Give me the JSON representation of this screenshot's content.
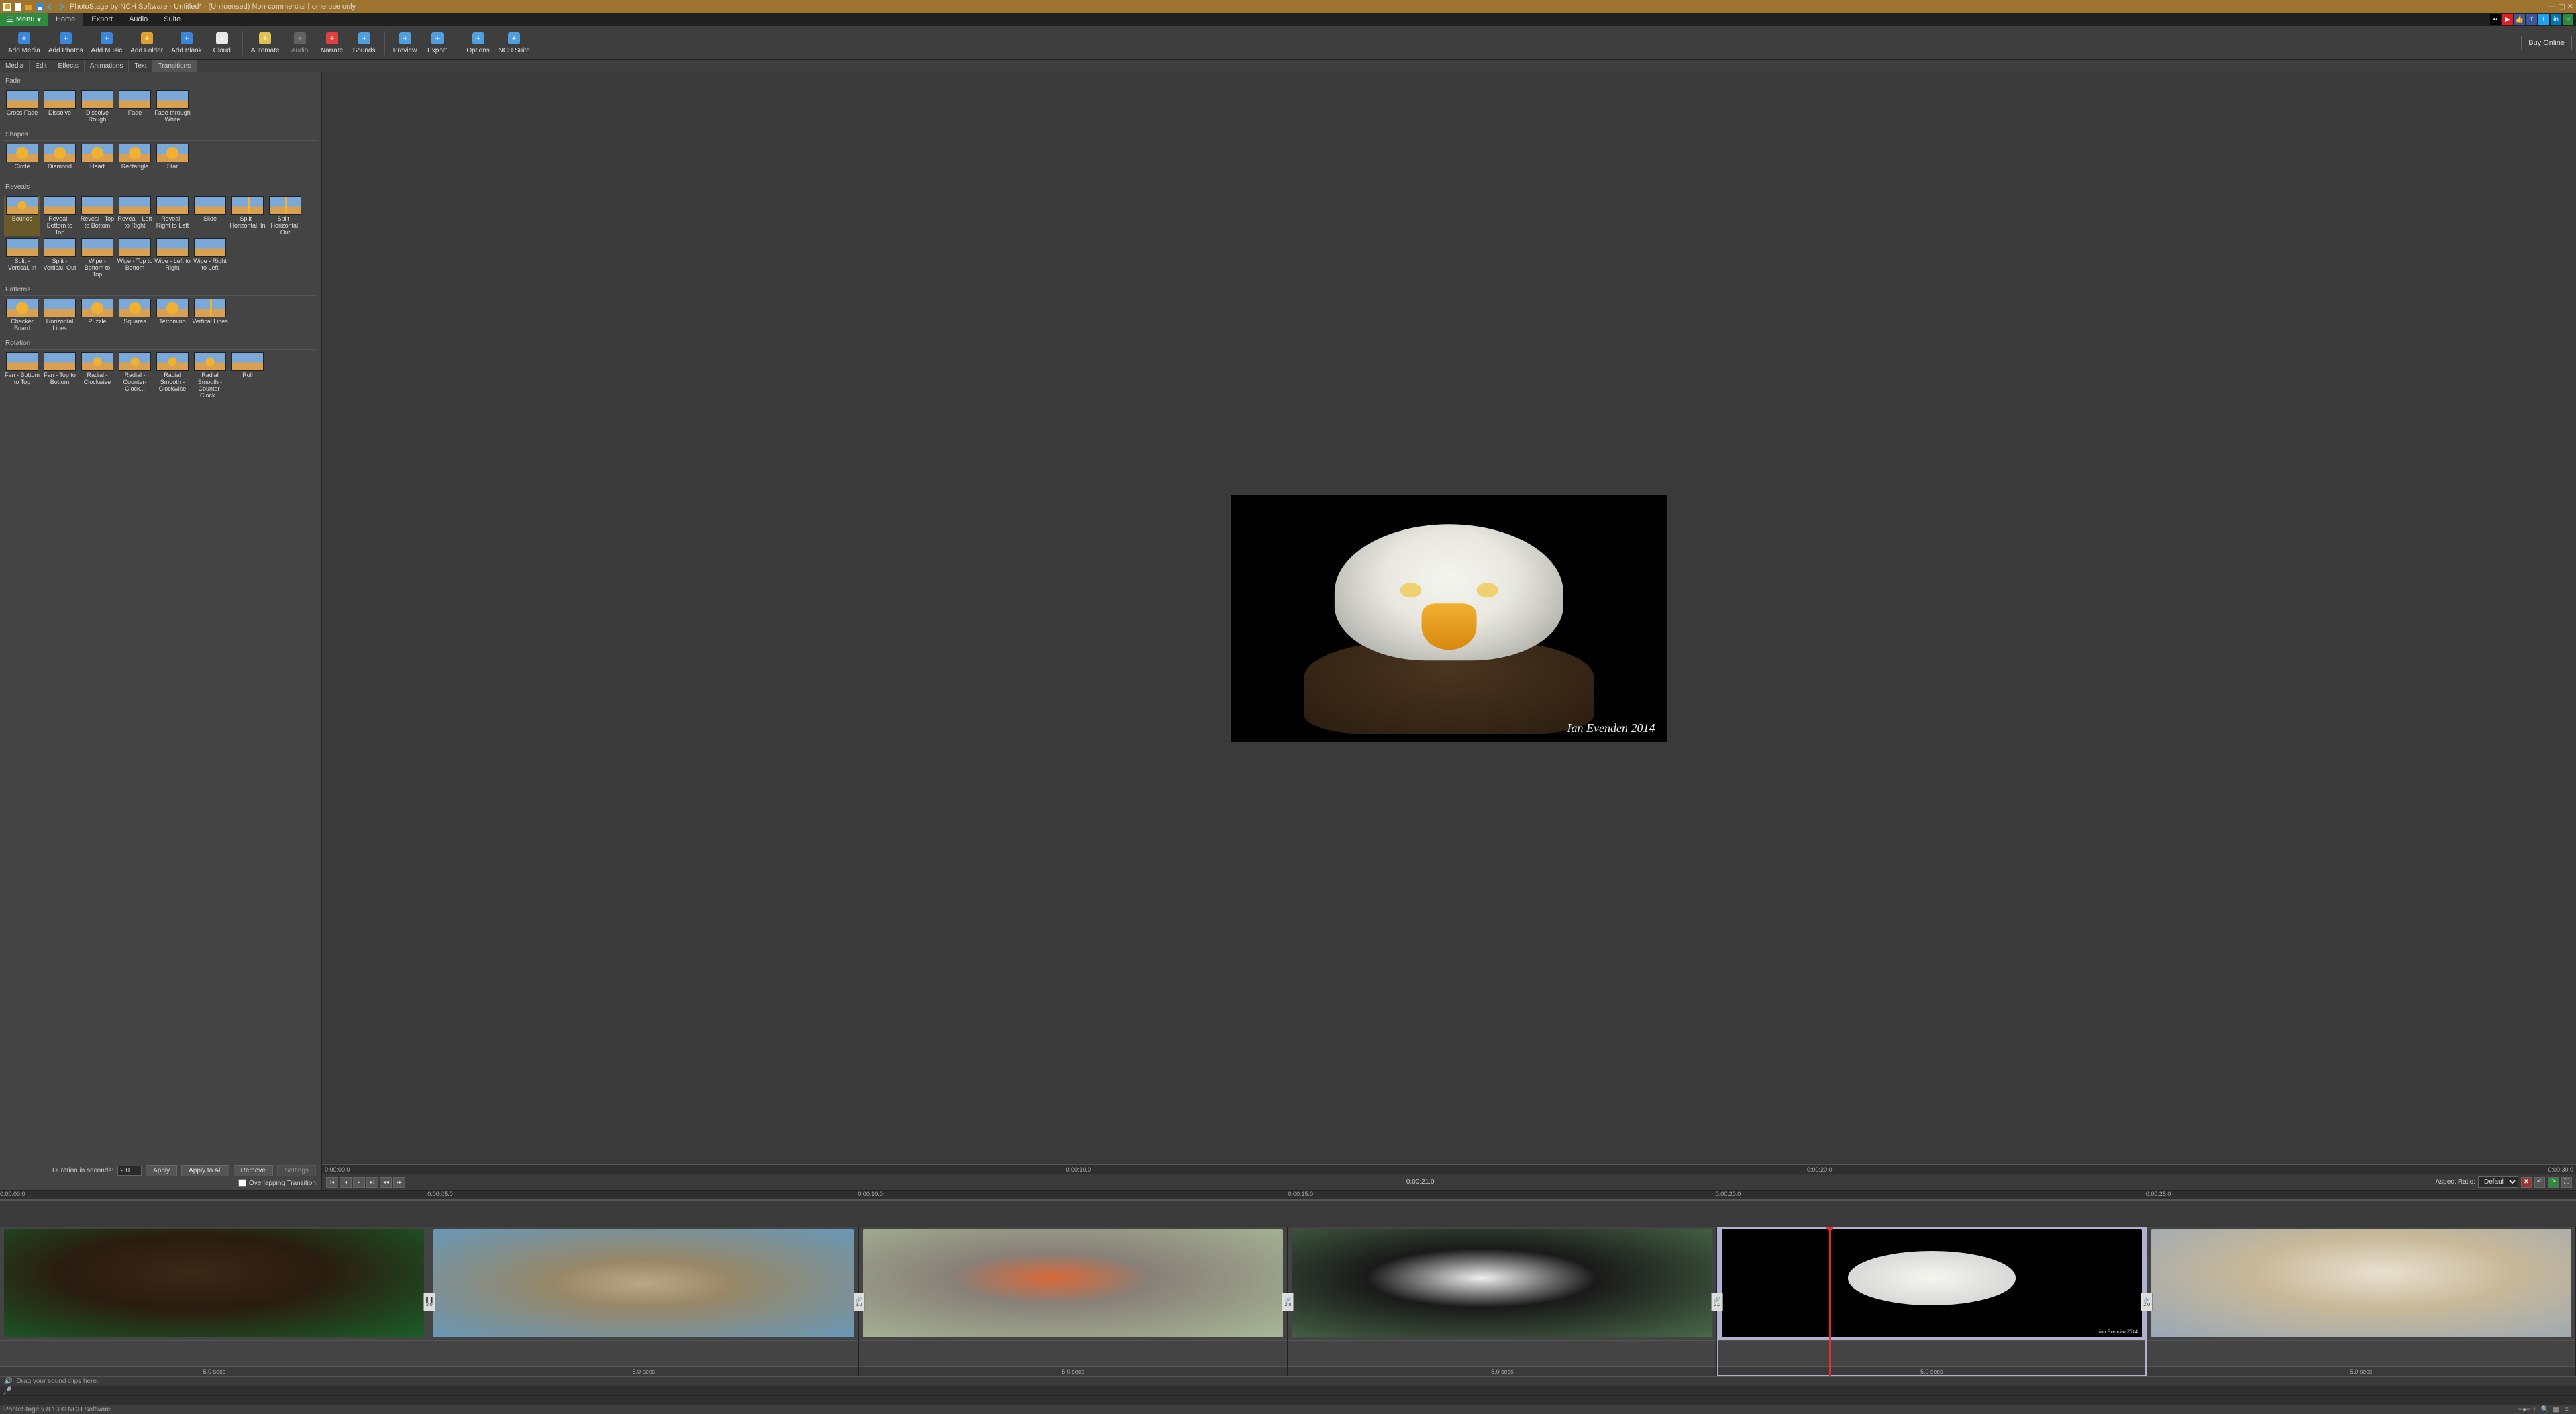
{
  "titlebar": {
    "title": "PhotoStage by NCH Software - Untitled* - (Unlicensed) Non-commercial home use only"
  },
  "menubar": {
    "menu": "Menu",
    "tabs": [
      "Home",
      "Export",
      "Audio",
      "Suite"
    ],
    "active": 0
  },
  "toolbar": {
    "buttons": [
      {
        "label": "Add Media",
        "icon": "add-media-icon",
        "color": "#3a86d8"
      },
      {
        "label": "Add Photos",
        "icon": "add-photos-icon",
        "color": "#3a86d8"
      },
      {
        "label": "Add Music",
        "icon": "add-music-icon",
        "color": "#3a86d8"
      },
      {
        "label": "Add Folder",
        "icon": "add-folder-icon",
        "color": "#e0a030"
      },
      {
        "label": "Add Blank",
        "icon": "add-blank-icon",
        "color": "#3a86d8"
      },
      {
        "label": "Cloud",
        "icon": "cloud-icon",
        "color": "#e8e8e8"
      },
      {
        "label": "Automate",
        "icon": "automate-icon",
        "color": "#e0c050",
        "sep_before": true
      },
      {
        "label": "Audio",
        "icon": "audio-icon",
        "color": "#888",
        "dim": true
      },
      {
        "label": "Narrate",
        "icon": "narrate-icon",
        "color": "#e04040"
      },
      {
        "label": "Sounds",
        "icon": "sounds-icon",
        "color": "#50a0e0"
      },
      {
        "label": "Preview",
        "icon": "preview-icon",
        "color": "#50a0e0",
        "sep_before": true
      },
      {
        "label": "Export",
        "icon": "export-icon",
        "color": "#50a0e0"
      },
      {
        "label": "Options",
        "icon": "options-icon",
        "color": "#50a0e0",
        "sep_before": true
      },
      {
        "label": "NCH Suite",
        "icon": "nch-suite-icon",
        "color": "#50a0e0"
      }
    ],
    "buy": "Buy Online"
  },
  "subtabs": {
    "items": [
      "Media",
      "Edit",
      "Effects",
      "Animations",
      "Text",
      "Transitions"
    ],
    "active": 5
  },
  "transitions": {
    "sections": [
      {
        "name": "Fade",
        "items": [
          {
            "label": "Cross Fade",
            "style": "plain"
          },
          {
            "label": "Dissolve",
            "style": "plain"
          },
          {
            "label": "Dissolve Rough",
            "style": "plain"
          },
          {
            "label": "Fade",
            "style": "plain"
          },
          {
            "label": "Fade through White",
            "style": "plain"
          }
        ]
      },
      {
        "name": "Shapes",
        "items": [
          {
            "label": "Circle",
            "style": "shape"
          },
          {
            "label": "Diamond",
            "style": "shape"
          },
          {
            "label": "Heart",
            "style": "shape"
          },
          {
            "label": "Rectangle",
            "style": "shape"
          },
          {
            "label": "Star",
            "style": "shape"
          }
        ]
      },
      {
        "name": "Reveals",
        "items": [
          {
            "label": "Bounce",
            "style": "burst",
            "selected": true
          },
          {
            "label": "Reveal - Bottom to Top",
            "style": "plain"
          },
          {
            "label": "Reveal - Top to Bottom",
            "style": "plain"
          },
          {
            "label": "Reveal - Left to Right",
            "style": "plain"
          },
          {
            "label": "Reveal - Right to Left",
            "style": "plain"
          },
          {
            "label": "Slide",
            "style": "plain"
          },
          {
            "label": "Split - Horizontal, In",
            "style": "line"
          },
          {
            "label": "Split - Horizontal, Out",
            "style": "line"
          },
          {
            "label": "Split - Vertical, In",
            "style": "plain"
          },
          {
            "label": "Split - Vertical, Out",
            "style": "plain"
          },
          {
            "label": "Wipe - Bottom to Top",
            "style": "plain"
          },
          {
            "label": "Wipe - Top to Bottom",
            "style": "plain"
          },
          {
            "label": "Wipe - Left to Right",
            "style": "plain"
          },
          {
            "label": "Wipe - Right to Left",
            "style": "plain"
          }
        ]
      },
      {
        "name": "Patterns",
        "items": [
          {
            "label": "Checker Board",
            "style": "shape"
          },
          {
            "label": "Horizontal Lines",
            "style": "plain"
          },
          {
            "label": "Puzzle",
            "style": "shape"
          },
          {
            "label": "Squares",
            "style": "shape"
          },
          {
            "label": "Tetromino",
            "style": "shape"
          },
          {
            "label": "Vertical Lines",
            "style": "line"
          }
        ]
      },
      {
        "name": "Rotation",
        "items": [
          {
            "label": "Fan - Bottom to Top",
            "style": "plain"
          },
          {
            "label": "Fan - Top to Bottom",
            "style": "plain"
          },
          {
            "label": "Radial - Clockwise",
            "style": "burst"
          },
          {
            "label": "Radial - Counter-Clock...",
            "style": "burst"
          },
          {
            "label": "Radial Smooth - Clockwise",
            "style": "burst"
          },
          {
            "label": "Radial Smooth - Counter-Clock...",
            "style": "burst"
          },
          {
            "label": "Roll",
            "style": "plain"
          }
        ]
      }
    ],
    "duration_label": "Duration in seconds:",
    "duration_value": "2.0",
    "apply": "Apply",
    "apply_all": "Apply to All",
    "remove": "Remove",
    "settings": "Settings",
    "overlap": "Overlapping Transition"
  },
  "preview": {
    "watermark": "Ian Evenden 2014",
    "ruler": [
      "0:00:00.0",
      "0:00:10.0",
      "0:00:20.0",
      "0:00:30.0"
    ],
    "time": "0:00:21.0",
    "aspect_label": "Aspect Ratio:",
    "aspect_value": "Default"
  },
  "timeline": {
    "ruler": [
      {
        "label": "0:00:00.0",
        "pct": 0
      },
      {
        "label": "0:00:05.0",
        "pct": 16.6
      },
      {
        "label": "0:00:10.0",
        "pct": 33.3
      },
      {
        "label": "0:00:15.0",
        "pct": 50
      },
      {
        "label": "0:00:20.0",
        "pct": 66.6
      },
      {
        "label": "0:00:25.0",
        "pct": 83.3
      }
    ],
    "playhead_pct": 71,
    "clips": [
      {
        "dur": "5.0 secs",
        "img": "vulture1",
        "link": null
      },
      {
        "dur": "5.0 secs",
        "img": "owl",
        "link": "2.0",
        "link_icon": "pause"
      },
      {
        "dur": "5.0 secs",
        "img": "robin",
        "link": "2.0",
        "link_icon": "chain"
      },
      {
        "dur": "5.0 secs",
        "img": "puffin",
        "link": "2.0",
        "link_icon": "chain"
      },
      {
        "dur": "5.0 secs",
        "img": "eagle-thumb",
        "link": "2.0",
        "link_icon": "chain",
        "selected": true,
        "watermark": "Ian Evenden 2014"
      },
      {
        "dur": "5.0 secs",
        "img": "vulture2",
        "link": "2.0",
        "link_icon": "chain"
      }
    ],
    "audio_hint": "Drag your sound clips here."
  },
  "statusbar": {
    "text": "PhotoStage v 8.13 © NCH Software"
  }
}
